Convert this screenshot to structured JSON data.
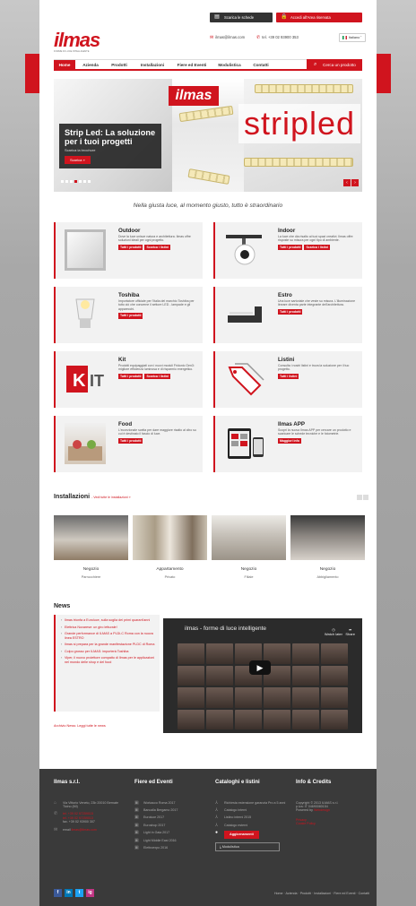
{
  "top_buttons": {
    "download_label": "Scarica le schede tecniche",
    "reserved_label": "Accedi all'Area riservata"
  },
  "logo": {
    "word": "ilmas",
    "tagline": "FORME DI LUCE INTELLIGENTE"
  },
  "contact": {
    "email": "ilmas@ilmas.com",
    "phone": "tel. +39 02 93900 353"
  },
  "language": {
    "label": "Italiano"
  },
  "nav": {
    "items": [
      "Home",
      "Azienda",
      "Prodotti",
      "Installazioni",
      "Fiere ed Eventi",
      "Modulistica",
      "Contatti"
    ],
    "search_label": "Cerca un prodotto"
  },
  "hero": {
    "logo_text": "ilmas",
    "big_text": "stripled",
    "title": "Strip Led: La soluzione per i tuoi progetti",
    "subtitle": "Scarica la brochure",
    "button": "Scarica »",
    "prev": "‹",
    "next": "›"
  },
  "slogan": "Nella giusta luce, al momento giusto, tutto è straordinario",
  "cards": [
    {
      "title": "Outdoor",
      "desc": "Dove la luce unisce natura e architettura. Ilmas offre soluzioni ideali per ogni progetto.",
      "buttons": [
        "Tutti i prodotti",
        "Scarica i listini"
      ]
    },
    {
      "title": "Indoor",
      "desc": "La luce che dia risalto ai tuoi spazi creativi. Ilmas offre risposte su misura per ogni tipo di ambiente.",
      "buttons": [
        "Tutti i prodotti",
        "Scarica i listini"
      ]
    },
    {
      "title": "Toshiba",
      "desc": "Importatore ufficiale per l'Italia del marchio Toshiba per tutto ciò che concerne il settore LED - lampade e gli apparecchi.",
      "buttons": [
        "Tutti i prodotti"
      ]
    },
    {
      "title": "Estro",
      "desc": "Una luce sartoriale che veste su misura. L'illuminazione lineare diventa parte integrante dell'architettura.",
      "buttons": [
        "Tutti i prodotti"
      ]
    },
    {
      "title": "Kit",
      "desc": "Prodotti equipaggiati con i nuovi moduli Fridonic Gen3: migliore efficienza luminosa e di risparmio energetico.",
      "buttons": [
        "Tutti i prodotti",
        "Scarica i listini"
      ]
    },
    {
      "title": "Listini",
      "desc": "Consulta i nostri listini e trova la soluzione per il tuo progetto.",
      "buttons": [
        "Tutti i listini"
      ]
    },
    {
      "title": "Food",
      "desc": "L'eccezionale scelta per dare maggiore risalto al cibo su cui è destinato il fascio di luce.",
      "buttons": [
        "Tutti i prodotti"
      ]
    },
    {
      "title": "Ilmas APP",
      "desc": "Scopri la nuova Ilmas APP per cercare un prodotto e scaricare le schede tecniche e le fotometrie.",
      "buttons": [
        "Maggiori info"
      ]
    }
  ],
  "installazioni": {
    "title": "Installazioni",
    "link": "- Vedi tutte le installazioni »",
    "items": [
      {
        "name": "Negozio",
        "caption": "Parrucchiere"
      },
      {
        "name": "Appartamento",
        "caption": "Privato"
      },
      {
        "name": "Negozio",
        "caption": "Filiale"
      },
      {
        "name": "Negozio",
        "caption": "Abbigliamento"
      }
    ]
  },
  "news": {
    "title": "News",
    "items": [
      "Ilmas trionfa a Euroluce, sulla soglia dei primi quarant'anni",
      "Elettrica Novarese: un giro letturale!",
      "Grande performance di ILMAS a PLDi-C Roma con la nuova linea ESTRO",
      "Ilmas si prepara per la grande manifestazione PLDC di Roma",
      "Colpo grosso per ILMAS: importerà Toshiba",
      "Viper, il nuovo proiettore compatto di Ilmas per le applicazioni nel mondo delle shop e del food"
    ],
    "archive": "Archivio News: Leggi tutte le news",
    "video_title": "ilmas - forme di luce intelligente",
    "watch_later": "Watch later",
    "share": "Share"
  },
  "footer": {
    "col1": {
      "title": "Ilmas s.r.l.",
      "address": "Via Vittorio Veneto, 23b 20010 Bernate Ticino (MI)",
      "tel1": "tel. +39 02 97259015",
      "tel2": "tel. +39 02 97259013",
      "fax": "fax. +39 02 93900 307",
      "email_label": "email",
      "email": "ilmas@ilmas.com"
    },
    "col2": {
      "title": "Fiere ed Eventi",
      "items": [
        "Workacco Roma 2017",
        "Bancalla Bergamo 2017",
        "Euroluce 2017",
        "Euroshop 2017",
        "Light in Gaia 2017",
        "Light Middle East 2016",
        "Elettroexpo 2016"
      ]
    },
    "col3": {
      "title": "Cataloghi e listini",
      "items": [
        "Richiesta estensione garanzia Pro a 5 anni",
        "Catalogo interni",
        "Listino interni 2015",
        "Catalogo esterni"
      ],
      "update": "Aggiornamenti",
      "modulistica": "Modulistica"
    },
    "col4": {
      "title": "Info & Credits",
      "copyright": "Copyright © 2013 ILMAS s.r.l.",
      "vat": "p.iva: IT 04690080154",
      "powered_label": "Powered by",
      "powered": "Webdesign",
      "privacy": "Privacy",
      "cookie": "Cookie Policy"
    },
    "social": [
      "f",
      "in",
      "t",
      "ig"
    ],
    "bottom_nav": "Home · Azienda · Prodotti · Installazioni · Fiere ed Eventi · Contatti"
  },
  "colors": {
    "accent": "#d0141e",
    "footer_bg": "#3a3a3a",
    "card_bg": "#f2f2f2"
  }
}
